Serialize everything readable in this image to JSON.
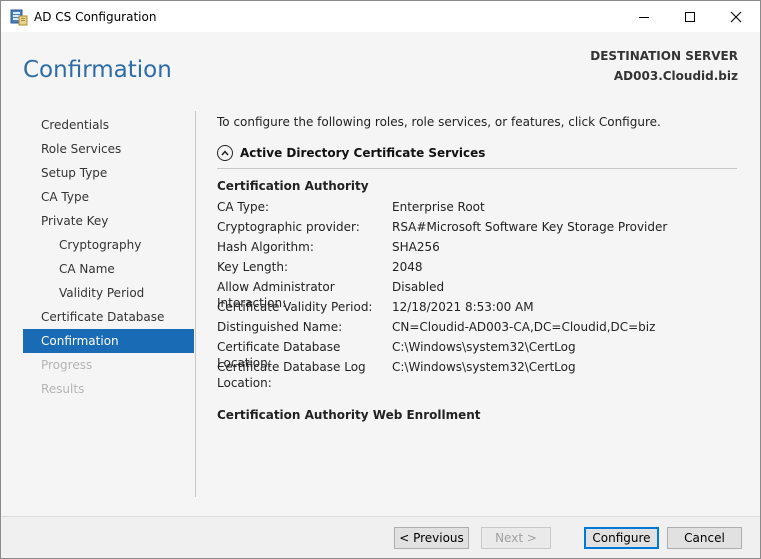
{
  "window": {
    "title": "AD CS Configuration",
    "controls": {
      "minimize": "minimize",
      "maximize": "maximize",
      "close": "close"
    }
  },
  "header": {
    "page_title": "Confirmation",
    "destination_label": "DESTINATION SERVER",
    "destination_server": "AD003.Cloudid.biz"
  },
  "nav": {
    "items": [
      {
        "label": "Credentials",
        "state": "normal",
        "level": 0
      },
      {
        "label": "Role Services",
        "state": "normal",
        "level": 0
      },
      {
        "label": "Setup Type",
        "state": "normal",
        "level": 0
      },
      {
        "label": "CA Type",
        "state": "normal",
        "level": 0
      },
      {
        "label": "Private Key",
        "state": "normal",
        "level": 0
      },
      {
        "label": "Cryptography",
        "state": "normal",
        "level": 1
      },
      {
        "label": "CA Name",
        "state": "normal",
        "level": 1
      },
      {
        "label": "Validity Period",
        "state": "normal",
        "level": 1
      },
      {
        "label": "Certificate Database",
        "state": "normal",
        "level": 0
      },
      {
        "label": "Confirmation",
        "state": "active",
        "level": 0
      },
      {
        "label": "Progress",
        "state": "disabled",
        "level": 0
      },
      {
        "label": "Results",
        "state": "disabled",
        "level": 0
      }
    ]
  },
  "content": {
    "intro": "To configure the following roles, role services, or features, click Configure.",
    "section_title": "Active Directory Certificate Services",
    "ca_group_title": "Certification Authority",
    "properties": [
      {
        "label": "CA Type:",
        "value": "Enterprise Root"
      },
      {
        "label": "Cryptographic provider:",
        "value": "RSA#Microsoft Software Key Storage Provider"
      },
      {
        "label": "Hash Algorithm:",
        "value": "SHA256"
      },
      {
        "label": "Key Length:",
        "value": "2048"
      },
      {
        "label": "Allow Administrator Interaction:",
        "value": "Disabled"
      },
      {
        "label": "Certificate Validity Period:",
        "value": "12/18/2021 8:53:00 AM"
      },
      {
        "label": "Distinguished Name:",
        "value": "CN=Cloudid-AD003-CA,DC=Cloudid,DC=biz"
      },
      {
        "label": "Certificate Database Location:",
        "value": "C:\\Windows\\system32\\CertLog"
      },
      {
        "label": "Certificate Database Log Location:",
        "value": "C:\\Windows\\system32\\CertLog"
      }
    ],
    "web_enrollment_title": "Certification Authority Web Enrollment"
  },
  "footer": {
    "previous": "< Previous",
    "next": "Next >",
    "configure": "Configure",
    "cancel": "Cancel"
  },
  "colors": {
    "accent": "#1a6bb5",
    "title_blue": "#2e6ca6",
    "disabled_text": "#b4b4b4"
  }
}
